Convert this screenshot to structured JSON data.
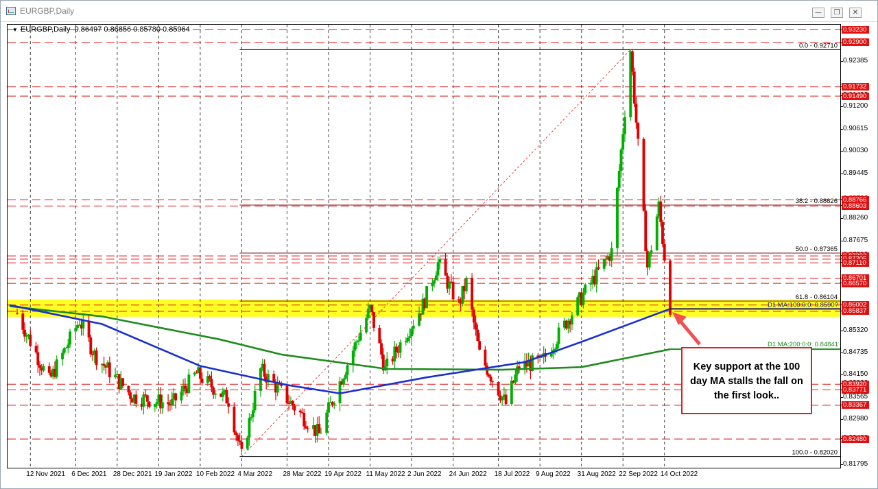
{
  "window": {
    "title": "EURGBP,Daily",
    "buttons": [
      "minimize",
      "restore",
      "close"
    ]
  },
  "header": {
    "symbol_line": "EURGBP,Daily  0.86497 0.86856 0.85780 0.85964"
  },
  "colors": {
    "bull": "#00b000",
    "bear": "#e00000",
    "ma100": "#1a2fd0",
    "ma200": "#1e8c1e",
    "zone": "#ffff00",
    "hline": "#e01010"
  },
  "price_ticks": [
    "0.93230",
    "0.92900",
    "0.92385",
    "0.91732",
    "0.91490",
    "0.91200",
    "0.90615",
    "0.90030",
    "0.89445",
    "0.88766",
    "0.88603",
    "0.88260",
    "0.87675",
    "0.87292",
    "0.87205",
    "0.87110",
    "0.86701",
    "0.86570",
    "0.86002",
    "0.85837",
    "0.85320",
    "0.84735",
    "0.84150",
    "0.83920",
    "0.83771",
    "0.83565",
    "0.83367",
    "0.82980",
    "0.82480",
    "0.82395",
    "0.81795"
  ],
  "price_labels": [
    "0.93230",
    "0.92900",
    "0.91732",
    "0.91490",
    "0.88766",
    "0.88603",
    "0.87292",
    "0.87205",
    "0.87110",
    "0.86701",
    "0.86570",
    "0.86002",
    "0.85837",
    "0.83920",
    "0.83771",
    "0.83367",
    "0.82480"
  ],
  "date_labels": [
    "12 Nov 2021",
    "6 Dec 2021",
    "28 Dec 2021",
    "19 Jan 2022",
    "10 Feb 2022",
    "4 Mar 2022",
    "28 Mar 2022",
    "19 Apr 2022",
    "11 May 2022",
    "2 Jun 2022",
    "24 Jun 2022",
    "18 Jul 2022",
    "9 Aug 2022",
    "31 Aug 2022",
    "22 Sep 2022",
    "14 Oct 2022"
  ],
  "fib_labels": [
    "0.0 - 0.92710",
    "38.2 - 0.88626",
    "50.0 - 0.87365",
    "61.8 - 0.86104",
    "100.0 - 0.82020"
  ],
  "ma_labels": [
    "D1 MA:100:0:0: 0.8590?",
    "D1 MA:200:0:0: 0.84841"
  ],
  "callout": {
    "lines": [
      "Key support at the 100",
      "day MA stalls the fall on",
      "the first look.."
    ]
  },
  "chart_data": {
    "type": "candlestick",
    "instrument": "EURGBP",
    "timeframe": "Daily",
    "last_bar": {
      "open": 0.86497,
      "high": 0.86856,
      "low": 0.8578,
      "close": 0.85964
    },
    "ylim": [
      0.8178,
      0.9333
    ],
    "x_range": [
      "2021-11-01",
      "2022-10-17"
    ],
    "trend_swings": [
      {
        "date": "2021-11-05",
        "price": 0.8578
      },
      {
        "date": "2021-11-22",
        "price": 0.84
      },
      {
        "date": "2021-12-08",
        "price": 0.856
      },
      {
        "date": "2021-12-16",
        "price": 0.847
      },
      {
        "date": "2022-01-05",
        "price": 0.836
      },
      {
        "date": "2022-01-26",
        "price": 0.834
      },
      {
        "date": "2022-02-08",
        "price": 0.842
      },
      {
        "date": "2022-02-25",
        "price": 0.835
      },
      {
        "date": "2022-03-04",
        "price": 0.8202
      },
      {
        "date": "2022-03-14",
        "price": 0.843
      },
      {
        "date": "2022-03-25",
        "price": 0.837
      },
      {
        "date": "2022-04-14",
        "price": 0.826
      },
      {
        "date": "2022-04-21",
        "price": 0.835
      },
      {
        "date": "2022-05-11",
        "price": 0.859
      },
      {
        "date": "2022-05-19",
        "price": 0.843
      },
      {
        "date": "2022-06-08",
        "price": 0.86
      },
      {
        "date": "2022-06-16",
        "price": 0.871
      },
      {
        "date": "2022-06-27",
        "price": 0.86
      },
      {
        "date": "2022-07-01",
        "price": 0.866
      },
      {
        "date": "2022-07-08",
        "price": 0.847
      },
      {
        "date": "2022-07-22",
        "price": 0.834
      },
      {
        "date": "2022-07-29",
        "price": 0.844
      },
      {
        "date": "2022-08-10",
        "price": 0.845
      },
      {
        "date": "2022-08-31",
        "price": 0.862
      },
      {
        "date": "2022-09-16",
        "price": 0.874
      },
      {
        "date": "2022-09-26",
        "price": 0.9271
      },
      {
        "date": "2022-10-05",
        "price": 0.87
      },
      {
        "date": "2022-10-11",
        "price": 0.886
      },
      {
        "date": "2022-10-17",
        "price": 0.8596
      }
    ],
    "ma100": [
      {
        "date": "2021-11-01",
        "value": 0.86
      },
      {
        "date": "2021-12-20",
        "value": 0.855
      },
      {
        "date": "2022-02-10",
        "value": 0.844
      },
      {
        "date": "2022-03-28",
        "value": 0.839
      },
      {
        "date": "2022-04-25",
        "value": 0.8368
      },
      {
        "date": "2022-06-10",
        "value": 0.841
      },
      {
        "date": "2022-08-01",
        "value": 0.845
      },
      {
        "date": "2022-09-01",
        "value": 0.8505
      },
      {
        "date": "2022-10-17",
        "value": 0.859
      }
    ],
    "ma200": [
      {
        "date": "2021-11-01",
        "value": 0.8597
      },
      {
        "date": "2021-12-20",
        "value": 0.857
      },
      {
        "date": "2022-02-20",
        "value": 0.851
      },
      {
        "date": "2022-03-25",
        "value": 0.847
      },
      {
        "date": "2022-05-20",
        "value": 0.8432
      },
      {
        "date": "2022-07-20",
        "value": 0.843
      },
      {
        "date": "2022-08-31",
        "value": 0.8437
      },
      {
        "date": "2022-10-17",
        "value": 0.8484
      }
    ],
    "horizontal_levels": [
      0.9323,
      0.929,
      0.91732,
      0.9149,
      0.88766,
      0.88603,
      0.87292,
      0.87205,
      0.8711,
      0.86701,
      0.8657,
      0.86002,
      0.85837,
      0.8392,
      0.83771,
      0.83367,
      0.8248
    ],
    "fibonacci": {
      "low": {
        "date": "2022-03-04",
        "price": 0.8202
      },
      "high": {
        "date": "2022-09-26",
        "price": 0.9271
      },
      "levels": [
        {
          "label": "0.0",
          "price": 0.9271
        },
        {
          "label": "38.2",
          "price": 0.88626
        },
        {
          "label": "50.0",
          "price": 0.87365
        },
        {
          "label": "61.8",
          "price": 0.86104
        },
        {
          "label": "100.0",
          "price": 0.8202
        }
      ]
    },
    "support_zone": [
      0.85837,
      0.86002
    ],
    "grid": true
  }
}
